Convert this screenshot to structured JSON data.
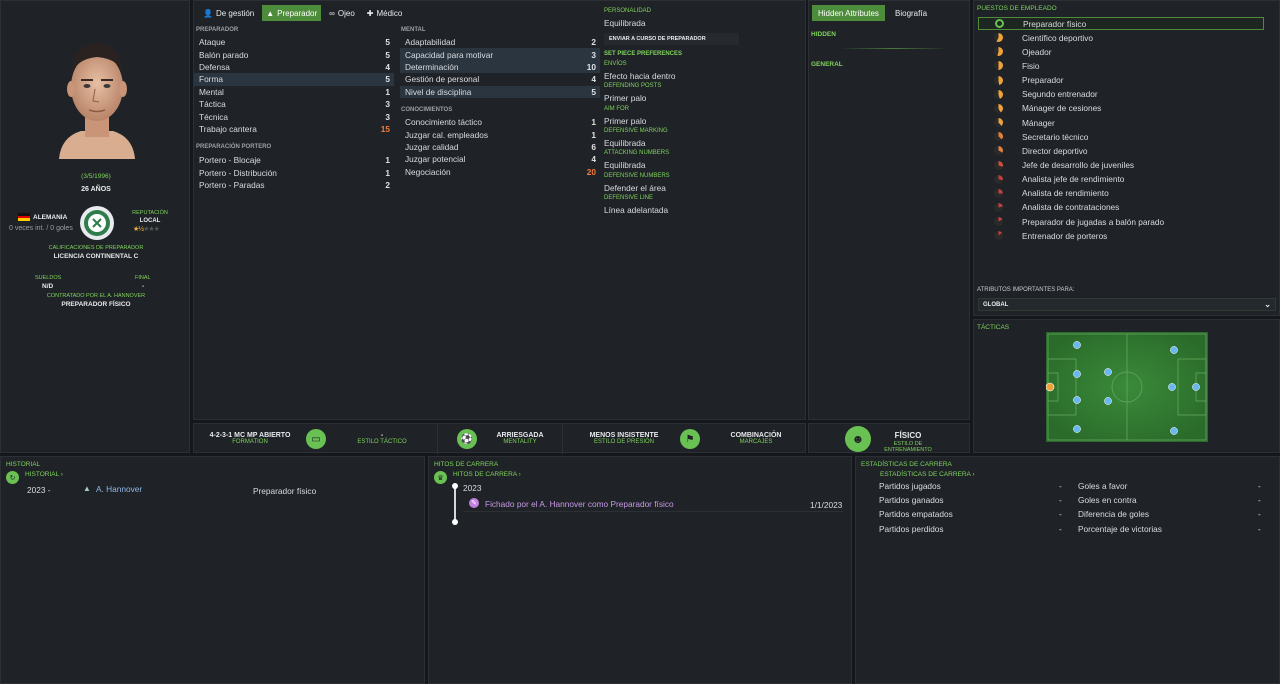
{
  "profile": {
    "dob": "(3/5/1996)",
    "age": "26 AÑOS",
    "nation": "ALEMANIA",
    "caps": "0 veces int. / 0 goles",
    "reputation_label": "REPUTACIÓN",
    "reputation": "LOCAL",
    "qual_label": "CALIFICACIONES DE PREPARADOR",
    "qual": "LICENCIA CONTINENTAL C",
    "wages_label": "SUELDOS",
    "wages": "N/D",
    "final_label": "FINAL",
    "final": "-",
    "contract_label": "CONTRATADO POR EL A. HANNOVER",
    "contract": "PREPARADOR FÍSICO"
  },
  "tabs": [
    {
      "label": "De gestión"
    },
    {
      "label": "Preparador"
    },
    {
      "label": "Ojeo"
    },
    {
      "label": "Médico"
    }
  ],
  "preparador": {
    "title": "PREPARADOR",
    "rows": [
      {
        "name": "Ataque",
        "value": "5"
      },
      {
        "name": "Balón parado",
        "value": "5"
      },
      {
        "name": "Defensa",
        "value": "4"
      },
      {
        "name": "Forma",
        "value": "5"
      },
      {
        "name": "Mental",
        "value": "1"
      },
      {
        "name": "Táctica",
        "value": "3"
      },
      {
        "name": "Técnica",
        "value": "3"
      },
      {
        "name": "Trabajo cantera",
        "value": "15"
      }
    ]
  },
  "portero": {
    "title": "PREPARACIÓN PORTERO",
    "rows": [
      {
        "name": "Portero - Blocaje",
        "value": "1"
      },
      {
        "name": "Portero - Distribución",
        "value": "1"
      },
      {
        "name": "Portero - Paradas",
        "value": "2"
      }
    ]
  },
  "mental": {
    "title": "MENTAL",
    "rows": [
      {
        "name": "Adaptabilidad",
        "value": "2"
      },
      {
        "name": "Capacidad para motivar",
        "value": "3"
      },
      {
        "name": "Determinación",
        "value": "10"
      },
      {
        "name": "Gestión de personal",
        "value": "4"
      },
      {
        "name": "Nivel de disciplina",
        "value": "5"
      }
    ]
  },
  "conocimientos": {
    "title": "CONOCIMIENTOS",
    "rows": [
      {
        "name": "Conocimiento táctico",
        "value": "1"
      },
      {
        "name": "Juzgar cal. empleados",
        "value": "1"
      },
      {
        "name": "Juzgar calidad",
        "value": "6"
      },
      {
        "name": "Juzgar potencial",
        "value": "4"
      },
      {
        "name": "Negociación",
        "value": "20"
      }
    ]
  },
  "personality": {
    "label": "PERSONALIDAD",
    "value": "Equilibrada",
    "course_button": "ENVIAR A CURSO DE PREPARADOR"
  },
  "setpiece": {
    "title": "SET PIECE PREFERENCES",
    "items": [
      {
        "label": "ENVÍOS",
        "value": "Efecto hacia dentro"
      },
      {
        "label": "DEFENDING POSTS",
        "value": "Primer palo"
      },
      {
        "label": "AIM FOR",
        "value": "Primer palo"
      },
      {
        "label": "DEFENSIVE MARKING",
        "value": "Equilibrada"
      },
      {
        "label": "ATTACKING NUMBERS",
        "value": "Equilibrada"
      },
      {
        "label": "DEFENSIVE NUMBERS",
        "value": "Defender el área"
      },
      {
        "label": "DEFENSIVE LINE",
        "value": "Línea adelantada"
      }
    ]
  },
  "tactics_bar": {
    "formation": "4-2-3-1 MC MP ABIERTO",
    "formation_label": "FORMATION",
    "style": "-",
    "style_label": "ESTILO TÁCTICO",
    "mentality": "ARRIESGADA",
    "mentality_label": "MENTALITY",
    "press": "MENOS INSISTENTE",
    "press_label": "ESTILO DE PRESIÓN",
    "marking": "COMBINACIÓN",
    "marking_label": "MARCAJES"
  },
  "hidden": {
    "tab1": "Hidden Attributes",
    "tab2": "Biografía",
    "hidden_label": "HIDDEN",
    "general_label": "GENERAL"
  },
  "training": {
    "value": "FÍSICO",
    "label": "ESTILO DE ENTRENAMIENTO"
  },
  "roles": {
    "title": "PUESTOS DE EMPLEADO",
    "items": [
      {
        "name": "Preparador físico",
        "color": "#6ac153"
      },
      {
        "name": "Científico deportivo",
        "color": "#f0a23a"
      },
      {
        "name": "Ojeador",
        "color": "#f0a23a"
      },
      {
        "name": "Fisio",
        "color": "#f0a23a"
      },
      {
        "name": "Preparador",
        "color": "#f0a23a"
      },
      {
        "name": "Segundo entrenador",
        "color": "#f0a23a"
      },
      {
        "name": "Mánager de cesiones",
        "color": "#f0a23a"
      },
      {
        "name": "Mánager",
        "color": "#f0a23a"
      },
      {
        "name": "Secretario técnico",
        "color": "#e0803a"
      },
      {
        "name": "Director deportivo",
        "color": "#e0803a"
      },
      {
        "name": "Jefe de desarrollo de juveniles",
        "color": "#d0503a"
      },
      {
        "name": "Analista jefe de rendimiento",
        "color": "#c0403a"
      },
      {
        "name": "Analista de rendimiento",
        "color": "#c0403a"
      },
      {
        "name": "Analista de contrataciones",
        "color": "#c0403a"
      },
      {
        "name": "Preparador de jugadas a balón parado",
        "color": "#c0403a"
      },
      {
        "name": "Entrenador de porteros",
        "color": "#c0403a"
      }
    ],
    "important_label": "ATRIBUTOS IMPORTANTES PARA:",
    "important_value": "GLOBAL"
  },
  "tactics_panel": {
    "title": "TÁCTICAS"
  },
  "history": {
    "title": "HISTORIAL",
    "link": "HISTORIAL ›",
    "rows": [
      {
        "years": "2023 -",
        "club": "A. Hannover",
        "role": "Preparador físico"
      }
    ]
  },
  "milestones": {
    "title": "HITOS DE CARRERA",
    "link": "HITOS DE CARRERA ›",
    "year": "2023",
    "event": "Fichado por el A. Hannover como Preparador físico",
    "date": "1/1/2023"
  },
  "career": {
    "title": "ESTADÍSTICAS DE CARRERA",
    "link": "ESTADÍSTICAS DE CARRERA ›",
    "left": [
      {
        "name": "Partidos jugados",
        "value": "-"
      },
      {
        "name": "Partidos ganados",
        "value": "-"
      },
      {
        "name": "Partidos empatados",
        "value": "-"
      },
      {
        "name": "Partidos perdidos",
        "value": "-"
      }
    ],
    "right": [
      {
        "name": "Goles a favor",
        "value": "-"
      },
      {
        "name": "Goles en contra",
        "value": "-"
      },
      {
        "name": "Diferencia de goles",
        "value": "-"
      },
      {
        "name": "Porcentaje de victorias",
        "value": "-"
      }
    ]
  },
  "colors": {
    "accent": "#4d8c3a",
    "green": "#7fd45d",
    "orange": "#ef7d3c"
  }
}
